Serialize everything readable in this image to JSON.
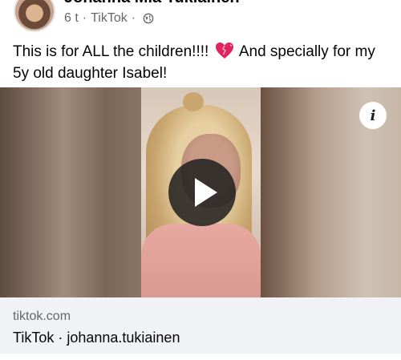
{
  "post": {
    "author": "Johanna Mia Tukiainen",
    "time": "6 t",
    "source": "TikTok",
    "separator": "·",
    "privacy_icon": "globe-icon",
    "text_part1": "This is for ALL the children!!!!",
    "text_emoji": "heart-emoji",
    "text_part2": "And specially for my 5y old daughter Isabel!"
  },
  "video": {
    "play_icon": "play-icon",
    "info_icon": "info-icon",
    "info_glyph": "i"
  },
  "link": {
    "domain": "tiktok.com",
    "title": "TikTok · johanna.tukiainen"
  },
  "colors": {
    "secondary_text": "#65676b",
    "card_bg": "#f0f2f5",
    "heart": "#e0245e"
  }
}
